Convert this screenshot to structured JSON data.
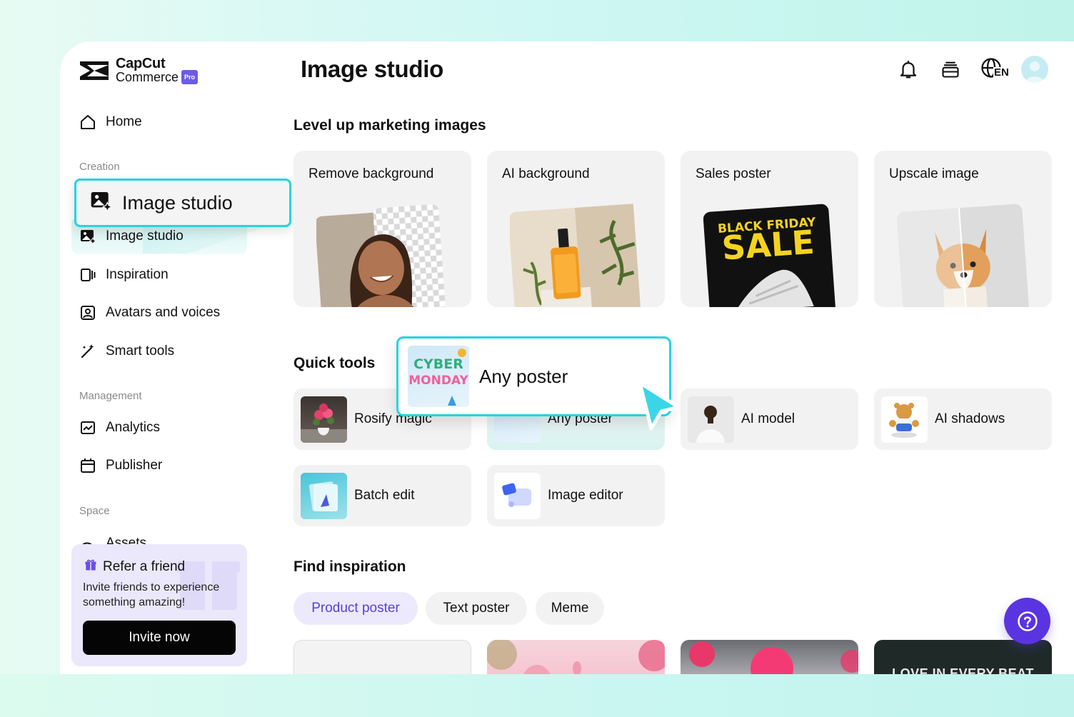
{
  "brand": {
    "line1": "CapCut",
    "line2": "Commerce",
    "badge": "Pro"
  },
  "header": {
    "title": "Image studio",
    "lang_label": "EN"
  },
  "sidebar": {
    "home": "Home",
    "creation_label": "Creation",
    "image_studio": "Image studio",
    "image_studio_callout": "Image studio",
    "inspiration": "Inspiration",
    "avatars": "Avatars and voices",
    "smart_tools": "Smart tools",
    "management_label": "Management",
    "analytics": "Analytics",
    "publisher": "Publisher",
    "space_label": "Space",
    "assets": "Assets"
  },
  "refer": {
    "title": "Refer a friend",
    "desc": "Invite friends to experience something amazing!",
    "button": "Invite now"
  },
  "sections": {
    "level_up": "Level up marketing images",
    "quick_tools": "Quick tools",
    "find_inspiration": "Find inspiration"
  },
  "feature_cards": [
    {
      "title": "Remove background"
    },
    {
      "title": "AI background"
    },
    {
      "title": "Sales poster",
      "art_text_1": "BLACK FRIDAY",
      "art_text_2": "SALE"
    },
    {
      "title": "Upscale image"
    }
  ],
  "quick_tools": {
    "rosify": "Rosify magic",
    "any_poster": "Any poster",
    "ai_model": "AI model",
    "ai_shadows": "AI shadows",
    "batch_edit": "Batch edit",
    "image_editor": "Image editor",
    "callout_label": "Any poster",
    "thumb_text_1": "CYBER",
    "thumb_text_2": "MONDAY"
  },
  "chips": [
    "Product poster",
    "Text poster",
    "Meme"
  ],
  "inspiration": {
    "card4_text": "LOVE IN EVERY BEAT"
  },
  "colors": {
    "accent": "#5a34e0",
    "highlight": "#24d4e0"
  }
}
